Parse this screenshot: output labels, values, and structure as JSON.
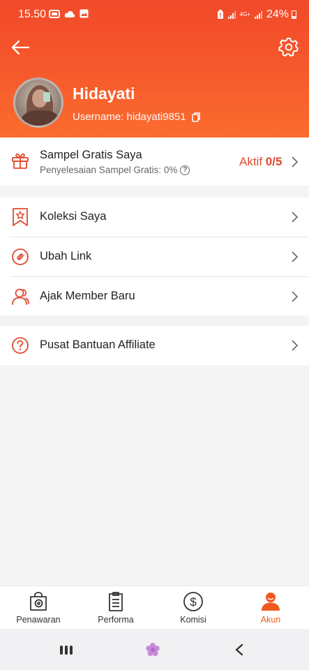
{
  "status_bar": {
    "time": "15.50",
    "battery": "24%",
    "network": "4G+"
  },
  "header": {
    "back_icon": "arrow-left-icon",
    "settings_icon": "gear-icon",
    "name": "Hidayati",
    "username_label": "Username: hidayati9851"
  },
  "sample": {
    "title": "Sampel Gratis Saya",
    "subtitle": "Penyelesaian Sampel Gratis: 0%",
    "status_prefix": "Aktif ",
    "status_count": "0/5",
    "icon": "gift-icon"
  },
  "menu": {
    "items": [
      {
        "label": "Koleksi Saya",
        "icon": "bookmark-star-icon"
      },
      {
        "label": "Ubah Link",
        "icon": "link-icon"
      },
      {
        "label": "Ajak Member Baru",
        "icon": "users-icon"
      }
    ],
    "help": {
      "label": "Pusat Bantuan Affiliate",
      "icon": "question-circle-icon"
    }
  },
  "bottom_nav": {
    "items": [
      {
        "label": "Penawaran",
        "icon": "offer-bag-icon"
      },
      {
        "label": "Performa",
        "icon": "clipboard-icon"
      },
      {
        "label": "Komisi",
        "icon": "dollar-circle-icon"
      },
      {
        "label": "Akun",
        "icon": "account-icon"
      }
    ],
    "active": "Akun"
  },
  "colors": {
    "accent": "#f05a1e",
    "header_top": "#f2492a",
    "header_bottom": "#fb6d2f",
    "icon_red": "#e04a2f"
  }
}
